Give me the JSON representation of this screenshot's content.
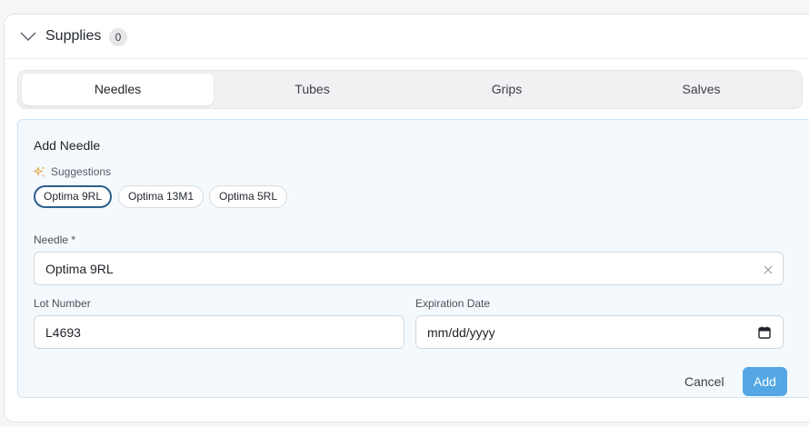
{
  "section": {
    "title": "Supplies",
    "count": "0"
  },
  "tabs": [
    {
      "label": "Needles",
      "active": true
    },
    {
      "label": "Tubes",
      "active": false
    },
    {
      "label": "Grips",
      "active": false
    },
    {
      "label": "Salves",
      "active": false
    }
  ],
  "form": {
    "title": "Add Needle",
    "suggestions_label": "Suggestions",
    "suggestions": [
      "Optima 9RL",
      "Optima 13M1",
      "Optima 5RL"
    ],
    "needle_label": "Needle *",
    "needle_value": "Optima 9RL",
    "lot_label": "Lot Number",
    "lot_value": "L4693",
    "expiration_label": "Expiration Date",
    "expiration_placeholder": "mm/dd/yyyy",
    "cancel_label": "Cancel",
    "add_label": "Add"
  },
  "icons": {
    "collapse": "chevron-down-icon",
    "suggestions": "sparkle-icon",
    "clear": "close-icon",
    "calendar": "calendar-icon"
  },
  "colors": {
    "accent": "#54a7e4",
    "selected_chip_border": "#2b5f8c",
    "sparkle": "#e8a33c",
    "panel_bg": "#f3f9fd"
  }
}
